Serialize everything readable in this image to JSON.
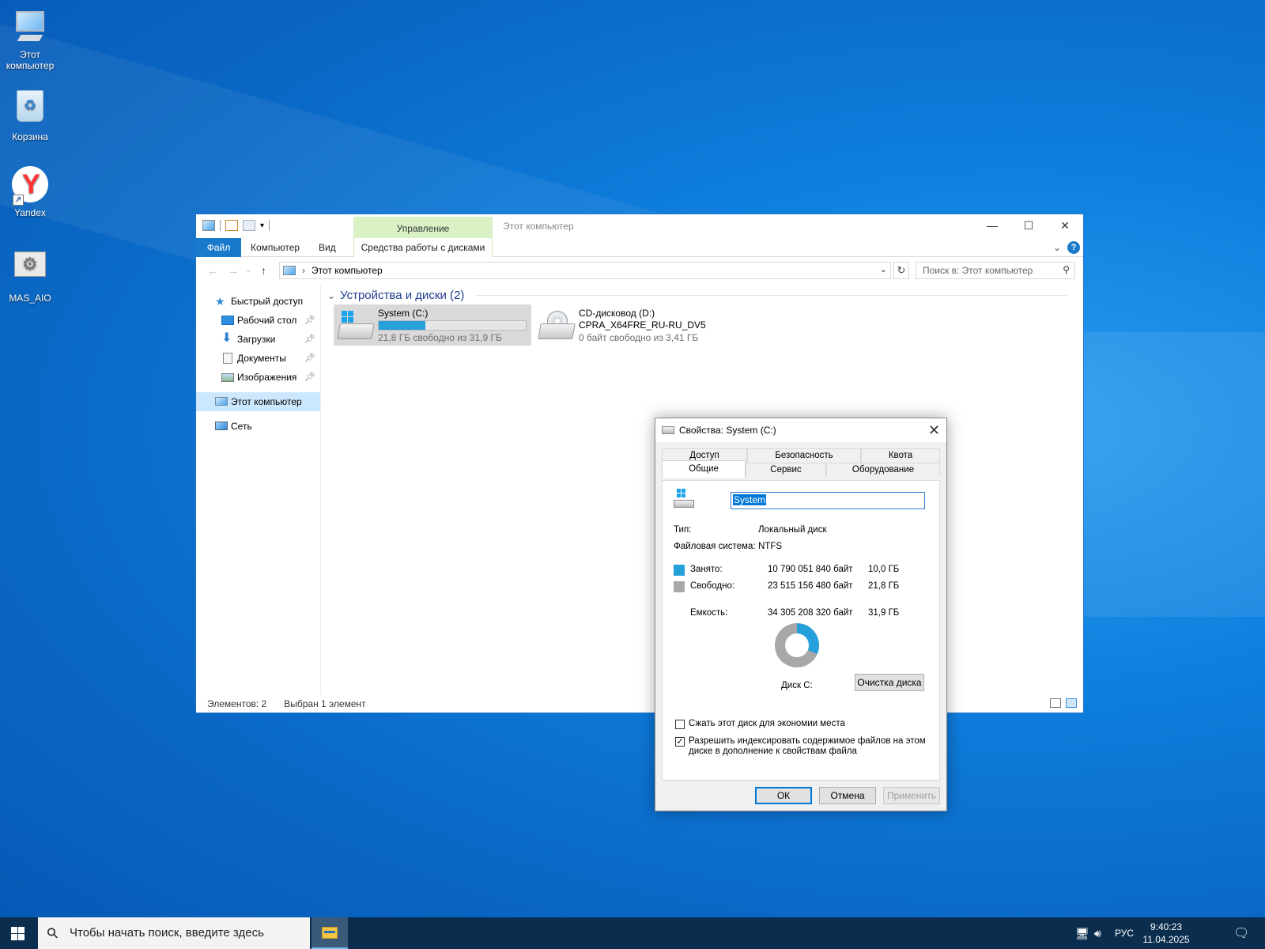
{
  "desktop": {
    "icons": [
      {
        "label": "Этот компьютер",
        "icon": "computer-icon"
      },
      {
        "label": "Корзина",
        "icon": "recycle-bin-icon"
      },
      {
        "label": "Yandex",
        "icon": "yandex-browser-icon"
      },
      {
        "label": "MAS_AIO",
        "icon": "settings-gears-icon"
      }
    ]
  },
  "explorer": {
    "title": "Этот компьютер",
    "contextual_tab": "Управление",
    "ribbon_tabs": {
      "file": "Файл",
      "computer": "Компьютер",
      "view": "Вид",
      "disk_tools": "Средства работы с дисками"
    },
    "window_buttons": {
      "minimize": "—",
      "maximize": "☐",
      "close": "✕"
    },
    "address": {
      "path": "Этот компьютер",
      "separator": "›"
    },
    "search": {
      "placeholder": "Поиск в: Этот компьютер"
    },
    "nav": {
      "quick_access": "Быстрый доступ",
      "items": [
        {
          "label": "Рабочий стол",
          "pinned": true
        },
        {
          "label": "Загрузки",
          "pinned": true
        },
        {
          "label": "Документы",
          "pinned": true
        },
        {
          "label": "Изображения",
          "pinned": true
        }
      ],
      "this_pc": "Этот компьютер",
      "network": "Сеть"
    },
    "group_header": "Устройства и диски (2)",
    "drives": [
      {
        "name": "System (C:)",
        "free_text": "21,8 ГБ свободно из 31,9 ГБ",
        "used_fraction": 0.315,
        "selected": true
      },
      {
        "name": "CD-дисковод (D:)",
        "volume": "CPRA_X64FRE_RU-RU_DV5",
        "free_text": "0 байт свободно из 3,41 ГБ",
        "selected": false
      }
    ],
    "status": {
      "items": "Элементов: 2",
      "selected": "Выбран 1 элемент"
    }
  },
  "properties": {
    "title": "Свойства: System (C:)",
    "tabs_back": [
      "Доступ",
      "Безопасность",
      "Квота"
    ],
    "tabs_front": [
      "Общие",
      "Сервис",
      "Оборудование"
    ],
    "active_tab": "Общие",
    "name_value": "System",
    "type_label": "Тип:",
    "type_value": "Локальный диск",
    "fs_label": "Файловая система:",
    "fs_value": "NTFS",
    "used": {
      "label": "Занято:",
      "bytes": "10 790 051 840 байт",
      "size": "10,0 ГБ",
      "color": "#26a0da"
    },
    "free": {
      "label": "Свободно:",
      "bytes": "23 515 156 480 байт",
      "size": "21,8 ГБ",
      "color": "#a8a8a8"
    },
    "capacity": {
      "label": "Емкость:",
      "bytes": "34 305 208 320 байт",
      "size": "31,9 ГБ"
    },
    "used_fraction": 0.315,
    "disk_label": "Диск C:",
    "cleanup_button": "Очистка диска",
    "compress": {
      "label": "Сжать этот диск для экономии места",
      "checked": false
    },
    "index": {
      "label_line1": "Разрешить индексировать содержимое файлов на этом",
      "label_line2": "диске в дополнение к свойствам файла",
      "checked": true
    },
    "buttons": {
      "ok": "ОК",
      "cancel": "Отмена",
      "apply": "Применить"
    }
  },
  "taskbar": {
    "search_placeholder": "Чтобы начать поиск, введите здесь",
    "language": "РУС",
    "time": "9:40:23",
    "date": "11.04.2025"
  }
}
